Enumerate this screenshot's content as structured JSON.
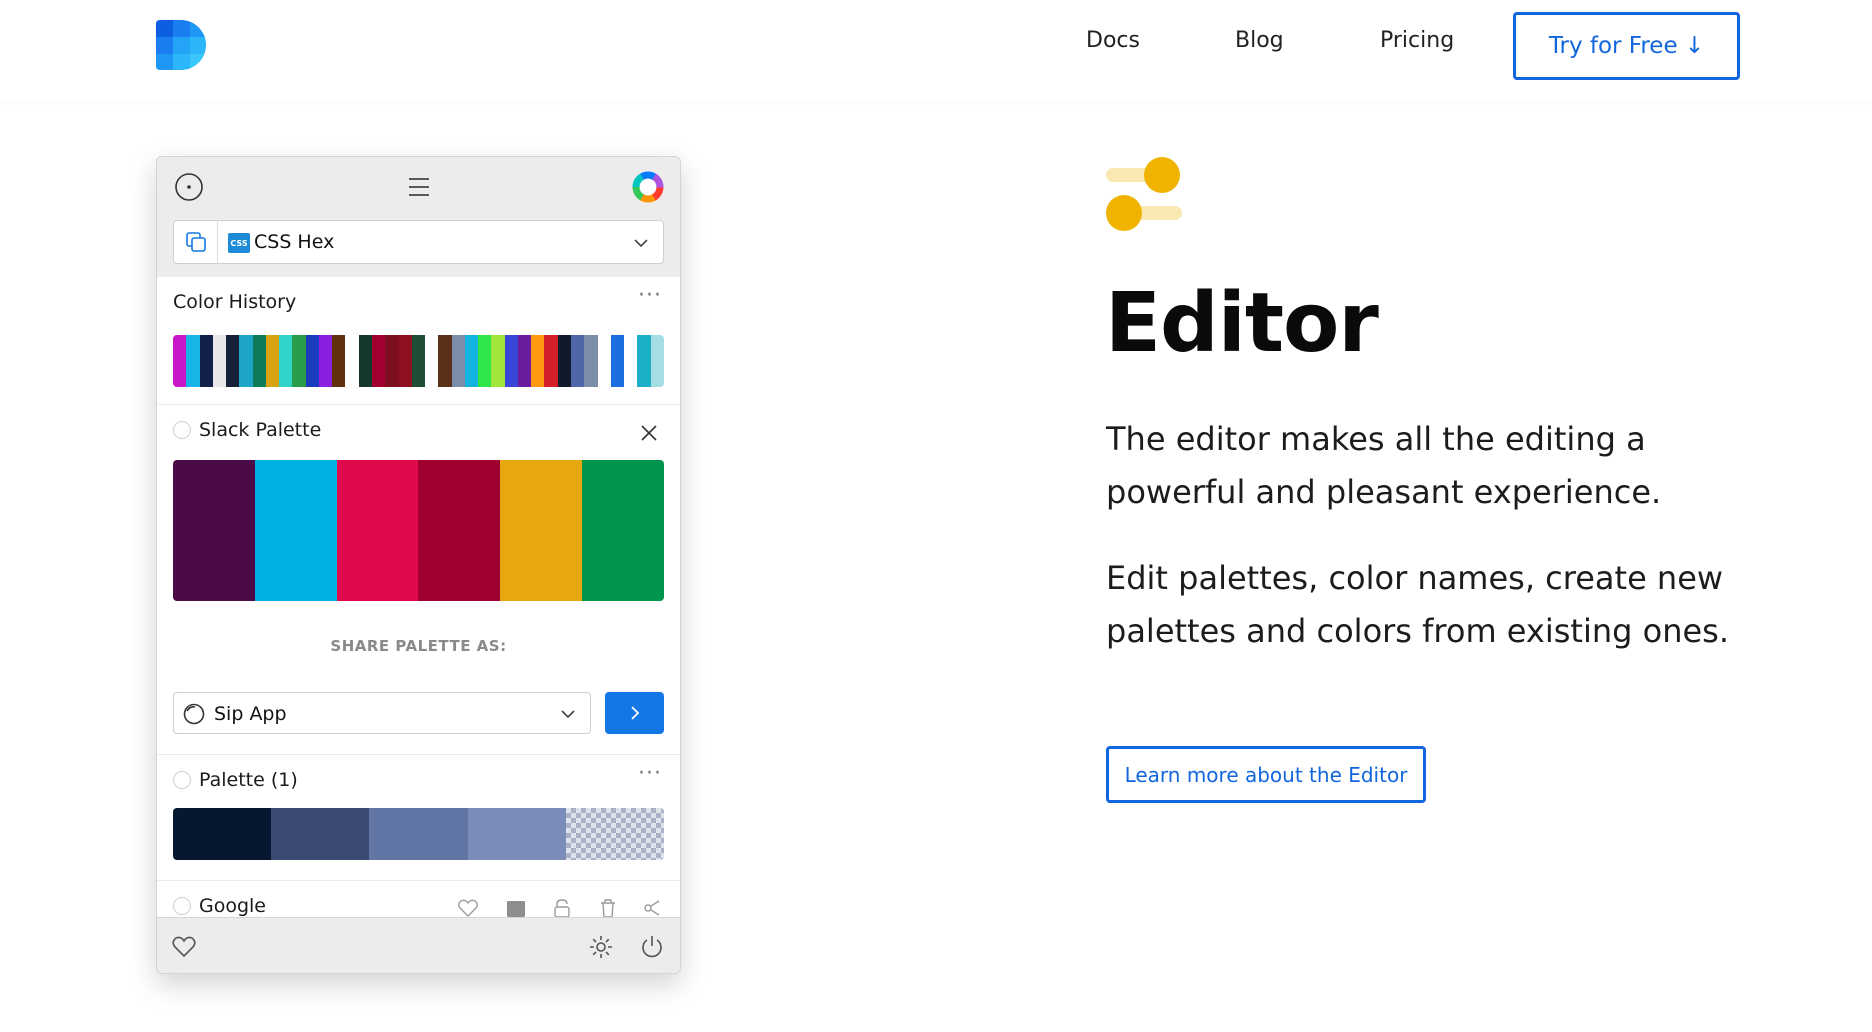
{
  "nav": {
    "docs": "Docs",
    "blog": "Blog",
    "pricing": "Pricing",
    "try_button": "Try for Free ↓"
  },
  "app": {
    "format": {
      "badge": "CSS",
      "label": "CSS Hex"
    },
    "color_history": {
      "title": "Color History",
      "colors": [
        "#c816c8",
        "#17b4e6",
        "#13204a",
        "#e8e8ea",
        "#132038",
        "#1da5c8",
        "#0e7a5a",
        "#d8a210",
        "#2fd3c9",
        "#2a9c4a",
        "#1c3cc0",
        "#8a1fe0",
        "#60300f",
        "#ffffff",
        "#14382b",
        "#a30032",
        "#7f0f20",
        "#8f1020",
        "#1e4e34",
        "#ffffff",
        "#5c2f18",
        "#7b8da8",
        "#14b4e0",
        "#2fe64a",
        "#9fe63a",
        "#3a46d8",
        "#6a1d9c",
        "#ff9a10",
        "#d4202a",
        "#111a2a",
        "#5066a8",
        "#7b8da8",
        "#ffffff",
        "#1d6ee0",
        "#ffffff",
        "#1cb0c8",
        "#a6dde4"
      ]
    },
    "slack": {
      "title": "Slack Palette",
      "colors": [
        "#4a0b46",
        "#00b1e3",
        "#df0a4b",
        "#9f002f",
        "#e7a70f",
        "#00954c"
      ],
      "share_label": "SHARE PALETTE AS:",
      "share_target": "Sip App"
    },
    "palette1": {
      "title": "Palette (1)",
      "colors": [
        "#07172f",
        "#3b4a73",
        "#6276a6",
        "#7b8cb9"
      ]
    },
    "google": {
      "title": "Google"
    }
  },
  "content": {
    "headline": "Editor",
    "paragraph_1": "The editor makes all the editing a powerful and pleasant experience.",
    "paragraph_2": "Edit palettes, color names, create new palettes and colors from existing ones.",
    "learn_more": "Learn more about the Editor",
    "accent_color": "#f0b400",
    "link_color": "#1266dd"
  }
}
